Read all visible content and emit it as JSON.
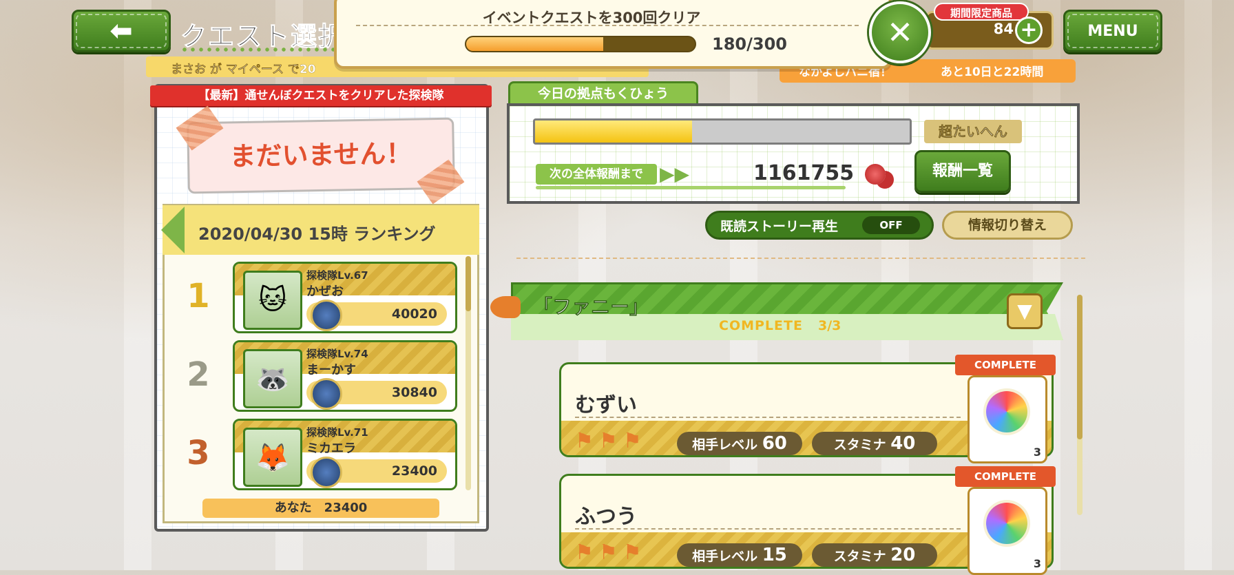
{
  "header": {
    "back_icon": "back-arrow-icon",
    "title": "クエスト選択",
    "marquee": "まさお が マイペース で20",
    "menu_label": "MENU"
  },
  "mission": {
    "title": "イベントクエストを300回クリア",
    "progress_text": "180/300",
    "progress_fraction": 0.6,
    "close_icon": "close-icon"
  },
  "currency": {
    "badge": "期間限定商品",
    "value": "84",
    "plus_icon": "plus-icon"
  },
  "event_banner": {
    "left_text": "なかよしパニ宿！",
    "right_text": "あと10日と22時間"
  },
  "left_panel": {
    "header": "【最新】通せんぼクエストをクリアした探検隊",
    "not_yet": "まだいません！",
    "ranking_title": "2020/04/30 15時 ランキング",
    "rows": [
      {
        "rank": "1",
        "level": "探検隊Lv.67",
        "name": "かぜお",
        "score": "40020"
      },
      {
        "rank": "2",
        "level": "探検隊Lv.74",
        "name": "まーかす",
        "score": "30840"
      },
      {
        "rank": "3",
        "level": "探検隊Lv.71",
        "name": "ミカエラ",
        "score": "23400"
      }
    ],
    "you_label": "あなた　23400"
  },
  "goal": {
    "tab": "今日の拠点もくひょう",
    "bar_fraction": 0.42,
    "difficulty": "超たいへん",
    "next_label": "次の全体報酬まで",
    "next_value": "1161755",
    "reward_button": "報酬一覧"
  },
  "controls": {
    "story_label": "既読ストーリー再生",
    "story_state": "OFF",
    "info_switch": "情報切り替え"
  },
  "quest": {
    "title": "「ファニー」",
    "complete": "COMPLETE",
    "count": "3/3",
    "cards": [
      {
        "name": "むずい",
        "enemy_label": "相手レベル",
        "enemy_level": "60",
        "stamina_label": "スタミナ",
        "stamina": "40",
        "ribbon": "COMPLETE",
        "reward_count": "3"
      },
      {
        "name": "ふつう",
        "enemy_label": "相手レベル",
        "enemy_level": "15",
        "stamina_label": "スタミナ",
        "stamina": "20",
        "ribbon": "COMPLETE",
        "reward_count": "3"
      }
    ]
  },
  "colors": {
    "accent_green": "#3f7d1d",
    "ribbon_red": "#e0312c",
    "gold": "#e7c552"
  }
}
